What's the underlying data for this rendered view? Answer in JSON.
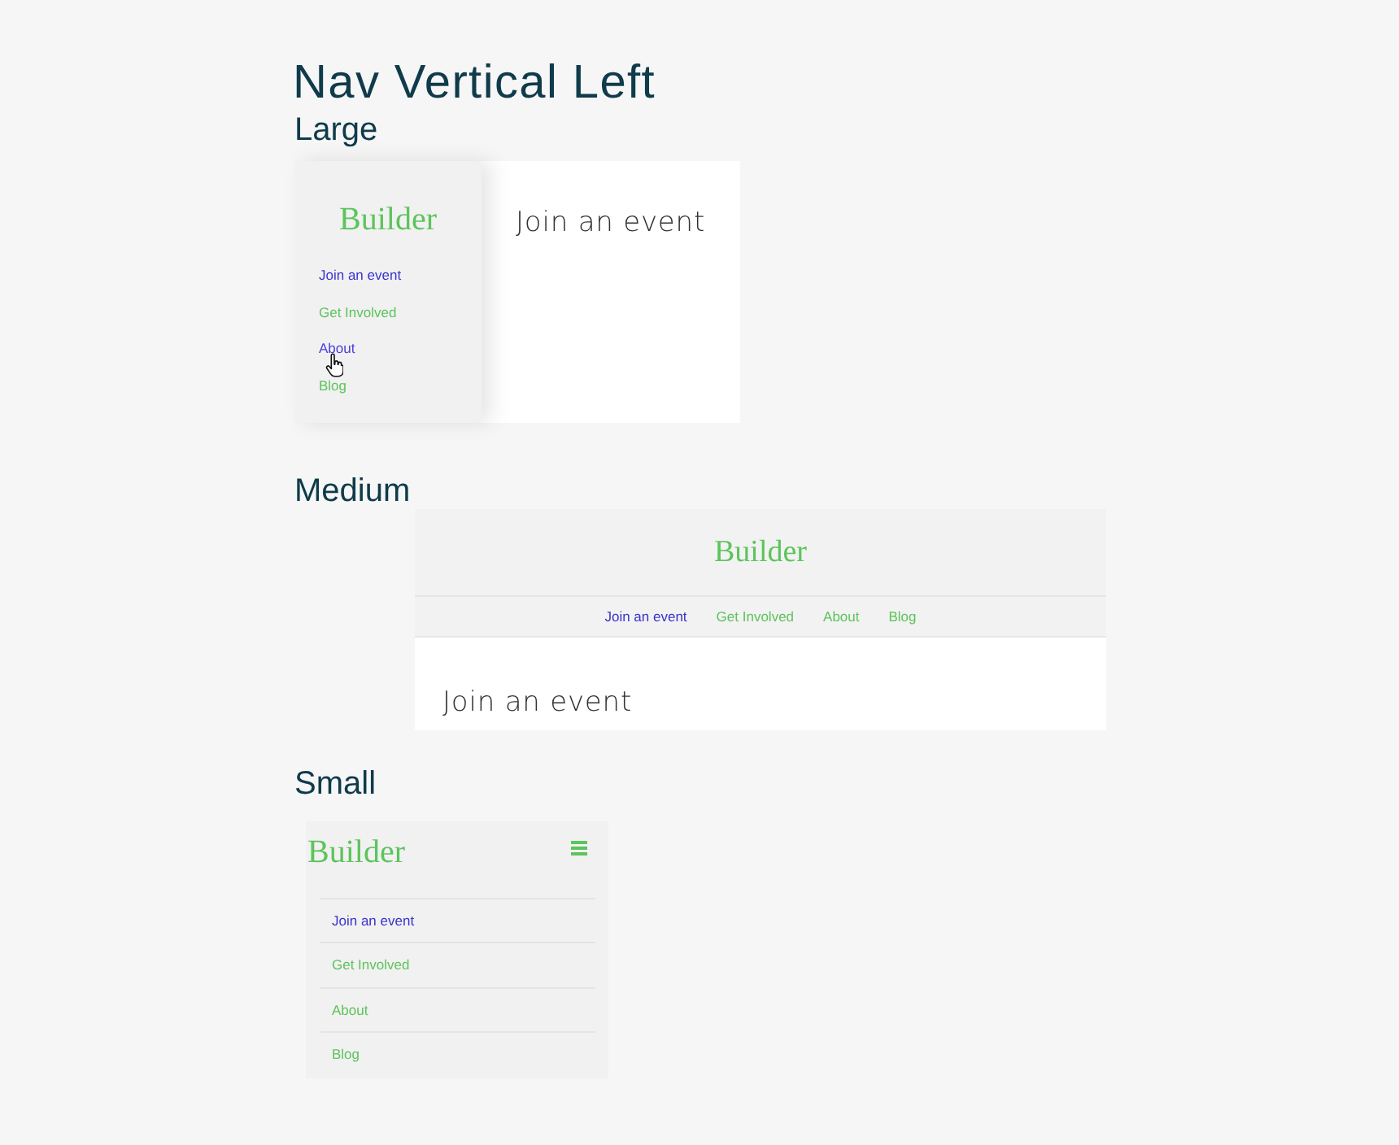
{
  "page": {
    "title": "Nav Vertical Left"
  },
  "sections": [
    {
      "kind": "large",
      "label": "Large",
      "brand": "Builder",
      "links": [
        {
          "label": "Join an event",
          "selected": true,
          "hovered": false
        },
        {
          "label": "Get Involved",
          "selected": false,
          "hovered": false
        },
        {
          "label": "About",
          "selected": false,
          "hovered": true
        },
        {
          "label": "Blog",
          "selected": false,
          "hovered": false
        }
      ],
      "content_heading": "Join an event"
    },
    {
      "kind": "medium",
      "label": "Medium",
      "brand": "Builder",
      "links": [
        {
          "label": "Join an event",
          "selected": true
        },
        {
          "label": "Get Involved",
          "selected": false
        },
        {
          "label": "About",
          "selected": false
        },
        {
          "label": "Blog",
          "selected": false
        }
      ],
      "content_heading": "Join an event"
    },
    {
      "kind": "small",
      "label": "Small",
      "brand": "Builder",
      "links": [
        {
          "label": "Join an event",
          "selected": true
        },
        {
          "label": "Get Involved",
          "selected": false
        },
        {
          "label": "About",
          "selected": false
        },
        {
          "label": "Blog",
          "selected": false
        }
      ]
    }
  ]
}
